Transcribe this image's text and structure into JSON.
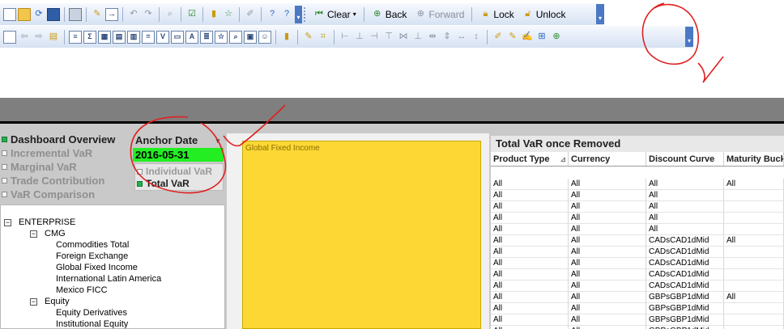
{
  "toolbar1": {
    "icons_left": [
      "new-document-icon",
      "open-folder-icon",
      "reload-icon",
      "save-icon",
      "print-icon",
      "edit-icon",
      "export-icon",
      "undo-icon",
      "redo-icon",
      "search-icon",
      "check-icon",
      "chart-icon",
      "favorite-star-icon",
      "edit-pencil-icon",
      "help-icon",
      "help-pointer-icon"
    ],
    "clear_label": "Clear",
    "back_label": "Back",
    "forward_label": "Forward",
    "lock_label": "Lock",
    "unlock_label": "Unlock"
  },
  "toolbar2": {
    "icons": [
      "new-sheet-icon",
      "sheet-back-icon",
      "sheet-forward-icon",
      "sheet-properties-icon",
      "listbox-icon",
      "statistics-box-icon",
      "multibox-icon",
      "table-box-icon",
      "chart-object-icon",
      "input-box-icon",
      "current-selections-icon",
      "button-object-icon",
      "text-object-icon",
      "line-arrow-icon",
      "bookmark-object-icon",
      "search-object-icon",
      "container-icon",
      "slider-icon",
      "chart-wizard-icon",
      "format-painter-icon",
      "align-left-icon",
      "align-center-icon",
      "align-right-icon",
      "align-top-icon",
      "align-middle-icon",
      "align-bottom-icon",
      "space-horizontal-icon",
      "space-vertical-icon",
      "same-width-icon",
      "same-height-icon",
      "properties-icon",
      "sheet-properties2-icon",
      "edit-script-icon",
      "table-viewer-icon",
      "reload-data-icon"
    ]
  },
  "left_menu": [
    {
      "label": "Dashboard Overview",
      "active": true
    },
    {
      "label": "Incremental VaR",
      "active": false
    },
    {
      "label": "Marginal VaR",
      "active": false
    },
    {
      "label": "Trade Contribution",
      "active": false
    },
    {
      "label": "VaR Comparison",
      "active": false
    }
  ],
  "anchor_date": {
    "label": "Anchor Date",
    "value": "2016-05-31"
  },
  "var_options": [
    {
      "label": "Individual VaR",
      "selected": false
    },
    {
      "label": "Total VaR",
      "selected": true
    }
  ],
  "tree": [
    {
      "label": "ENTERPRISE",
      "toggle": "−"
    },
    {
      "label": "CMG",
      "toggle": "−"
    },
    {
      "label": "Commodities Total"
    },
    {
      "label": "Foreign Exchange"
    },
    {
      "label": "Global Fixed Income"
    },
    {
      "label": "International Latin America"
    },
    {
      "label": "Mexico FICC"
    },
    {
      "label": "Equity",
      "toggle": "−"
    },
    {
      "label": "Equity Derivatives"
    },
    {
      "label": "Institutional Equity"
    }
  ],
  "chart_panel": {
    "label": "Global Fixed Income",
    "color": "#fdd835"
  },
  "table": {
    "title": "Total VaR once Removed",
    "columns": [
      "Product Type",
      "Currency",
      "Discount Curve",
      "Maturity Bucket"
    ],
    "rows": [
      [
        "All",
        "All",
        "All",
        "All"
      ],
      [
        "All",
        "All",
        "All",
        ""
      ],
      [
        "All",
        "All",
        "All",
        ""
      ],
      [
        "All",
        "All",
        "All",
        ""
      ],
      [
        "All",
        "All",
        "All",
        ""
      ],
      [
        "All",
        "All",
        "CADsCAD1dMid",
        "All"
      ],
      [
        "All",
        "All",
        "CADsCAD1dMid",
        ""
      ],
      [
        "All",
        "All",
        "CADsCAD1dMid",
        ""
      ],
      [
        "All",
        "All",
        "CADsCAD1dMid",
        ""
      ],
      [
        "All",
        "All",
        "CADsCAD1dMid",
        ""
      ],
      [
        "All",
        "All",
        "GBPsGBP1dMid",
        "All"
      ],
      [
        "All",
        "All",
        "GBPsGBP1dMid",
        ""
      ],
      [
        "All",
        "All",
        "GBPsGBP1dMid",
        ""
      ],
      [
        "All",
        "All",
        "GBPsGBP1dMid",
        ""
      ]
    ]
  },
  "colors": {
    "accent_green": "#22ee22",
    "annotation_red": "#e02020",
    "toolbar_blue": "#4a78c4"
  }
}
